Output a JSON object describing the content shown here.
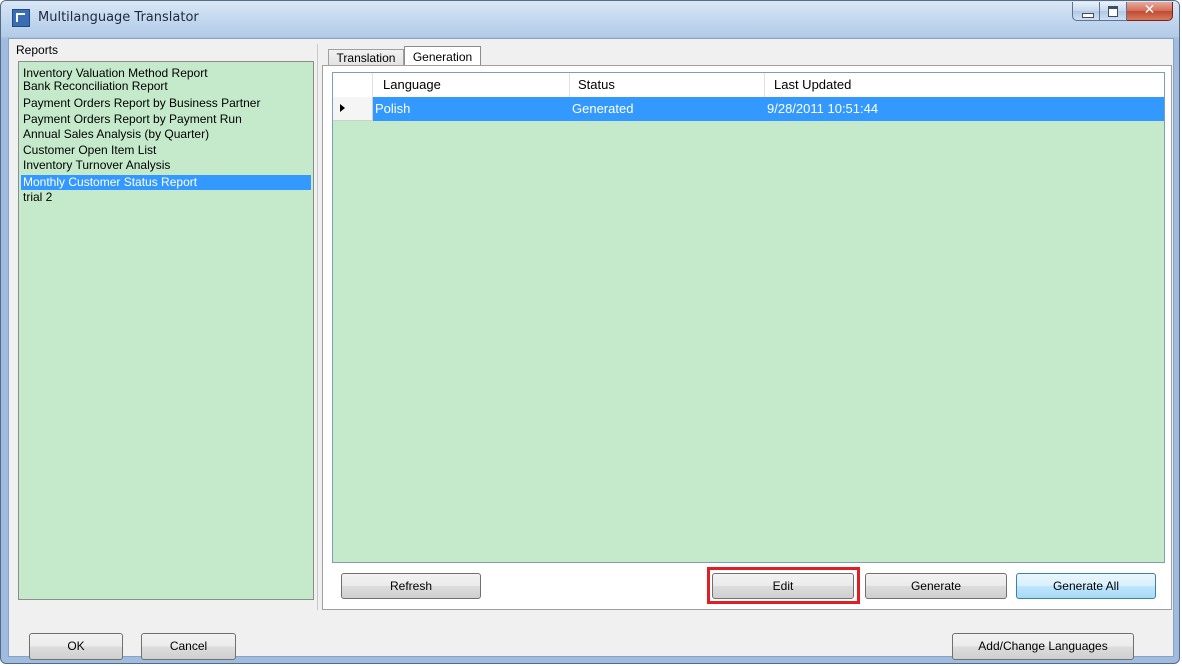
{
  "window": {
    "title": "Multilanguage Translator"
  },
  "reports": {
    "label": "Reports",
    "items": [
      "Inventory Valuation Method Report",
      "Bank Reconciliation Report",
      "Payment Orders Report by Business Partner",
      "Payment Orders Report by Payment Run",
      "Annual Sales Analysis (by Quarter)",
      "Customer Open Item List",
      "Inventory Turnover Analysis",
      "Monthly Customer Status Report",
      "trial 2"
    ],
    "selected": "Monthly Customer Status Report"
  },
  "tabs": [
    {
      "label": "Translation",
      "active": false
    },
    {
      "label": "Generation",
      "active": true
    }
  ],
  "grid": {
    "columns": [
      "Language",
      "Status",
      "Last Updated"
    ],
    "rows": [
      {
        "language": "Polish",
        "status": "Generated",
        "last_updated": "9/28/2011 10:51:44"
      }
    ]
  },
  "buttons": {
    "refresh": "Refresh",
    "edit": "Edit",
    "generate": "Generate",
    "generate_all": "Generate All",
    "ok": "OK",
    "cancel": "Cancel",
    "add_change_languages": "Add/Change Languages"
  },
  "colors": {
    "list_background": "#c5eacb",
    "selection": "#3399ff",
    "highlight": "#e01e24"
  }
}
